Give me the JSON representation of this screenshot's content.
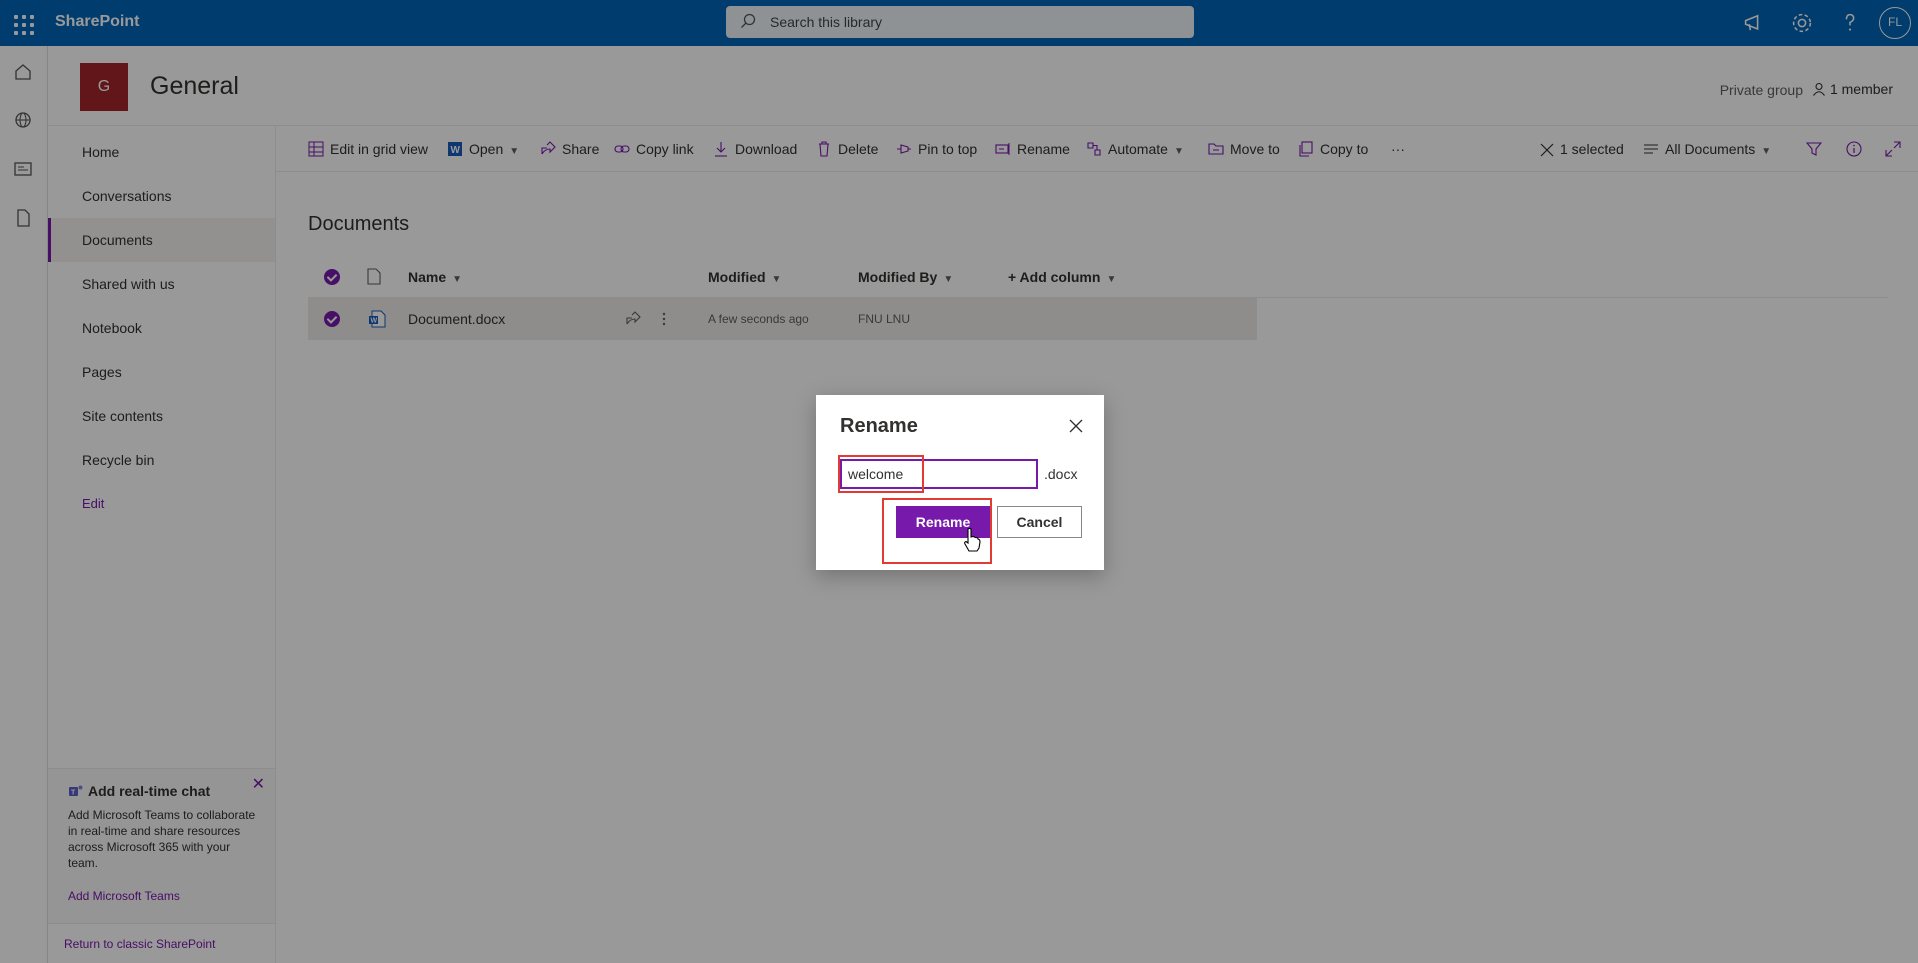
{
  "suitebar": {
    "app_name": "SharePoint",
    "search_placeholder": "Search this library",
    "avatar_initials": "FL"
  },
  "site": {
    "logo_letter": "G",
    "title": "General",
    "privacy": "Private group",
    "members": "1 member"
  },
  "nav": {
    "items": [
      {
        "label": "Home"
      },
      {
        "label": "Conversations"
      },
      {
        "label": "Documents"
      },
      {
        "label": "Shared with us"
      },
      {
        "label": "Notebook"
      },
      {
        "label": "Pages"
      },
      {
        "label": "Site contents"
      },
      {
        "label": "Recycle bin"
      }
    ],
    "edit_label": "Edit",
    "teams_card": {
      "title": "Add real-time chat",
      "body": "Add Microsoft Teams to collaborate in real-time and share resources across Microsoft 365 with your team.",
      "link": "Add Microsoft Teams"
    },
    "classic_link": "Return to classic SharePoint"
  },
  "commandbar": {
    "edit_grid": "Edit in grid view",
    "open": "Open",
    "share": "Share",
    "copy_link": "Copy link",
    "download": "Download",
    "delete": "Delete",
    "pin_to_top": "Pin to top",
    "rename": "Rename",
    "automate": "Automate",
    "move_to": "Move to",
    "copy_to": "Copy to",
    "more": "···",
    "selected": "1 selected",
    "view": "All Documents"
  },
  "library": {
    "title": "Documents",
    "columns": {
      "name": "Name",
      "modified": "Modified",
      "modified_by": "Modified By",
      "add_column": "+ Add column"
    },
    "rows": [
      {
        "name": "Document.docx",
        "modified": "A few seconds ago",
        "modified_by": "FNU LNU"
      }
    ]
  },
  "dialog": {
    "title": "Rename",
    "input_value": "welcome",
    "extension": ".docx",
    "primary_button": "Rename",
    "cancel_button": "Cancel"
  },
  "colors": {
    "suitebar": "#0364b8",
    "accent": "#7719aa",
    "site_logo": "#a4262c",
    "highlight": "#e03c31"
  }
}
